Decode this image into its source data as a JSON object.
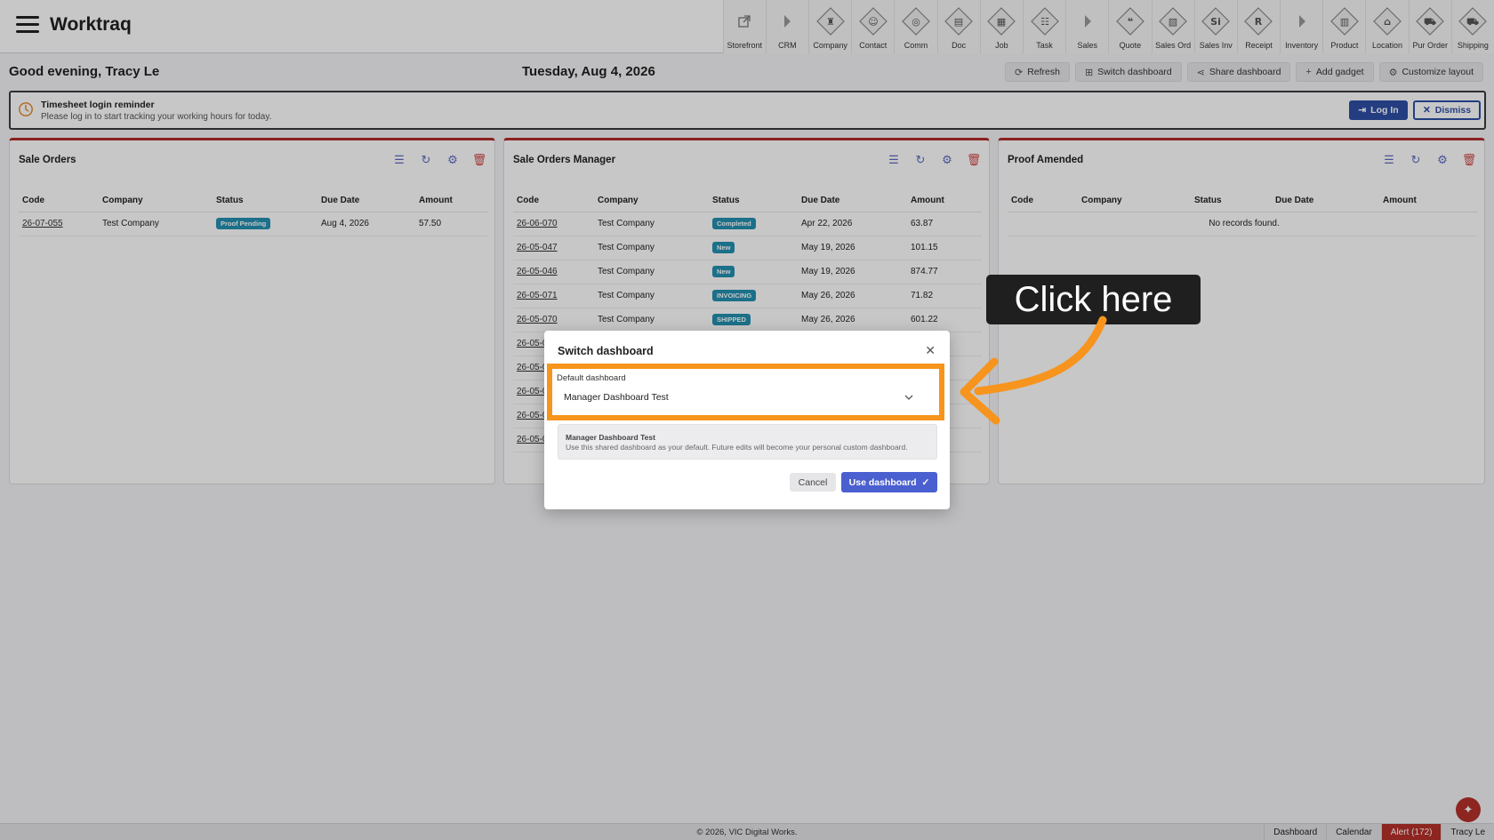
{
  "app": {
    "title": "Worktraq"
  },
  "modules": [
    {
      "label": "Storefront",
      "icon": "external-link-icon"
    },
    {
      "label": "CRM",
      "icon": "caret-right-icon"
    },
    {
      "label": "Company",
      "icon": "company-icon"
    },
    {
      "label": "Contact",
      "icon": "contact-icon"
    },
    {
      "label": "Comm",
      "icon": "comm-icon"
    },
    {
      "label": "Doc",
      "icon": "doc-icon"
    },
    {
      "label": "Job",
      "icon": "job-icon"
    },
    {
      "label": "Task",
      "icon": "task-icon"
    },
    {
      "label": "Sales",
      "icon": "caret-right-icon"
    },
    {
      "label": "Quote",
      "icon": "quote-icon"
    },
    {
      "label": "Sales Ord",
      "icon": "sales-order-icon"
    },
    {
      "label": "Sales Inv",
      "icon": "sales-invoice-icon"
    },
    {
      "label": "Receipt",
      "icon": "receipt-icon"
    },
    {
      "label": "Inventory",
      "icon": "caret-right-icon"
    },
    {
      "label": "Product",
      "icon": "product-icon"
    },
    {
      "label": "Location",
      "icon": "location-icon"
    },
    {
      "label": "Pur Order",
      "icon": "purchase-order-icon"
    },
    {
      "label": "Shipping",
      "icon": "shipping-icon"
    }
  ],
  "header": {
    "greeting": "Good evening, Tracy Le",
    "date": "Tuesday, Aug 4, 2026",
    "actions": {
      "refresh": "Refresh",
      "switch": "Switch dashboard",
      "share": "Share dashboard",
      "add": "Add gadget",
      "customize": "Customize layout"
    }
  },
  "reminder": {
    "title": "Timesheet login reminder",
    "subtitle": "Please log in to start tracking your working hours for today.",
    "login_label": "Log In",
    "dismiss_label": "Dismiss"
  },
  "columns": {
    "code": "Code",
    "company": "Company",
    "status": "Status",
    "due": "Due Date",
    "amount": "Amount"
  },
  "gadget1": {
    "title": "Sale Orders",
    "rows": [
      {
        "code": "26-07-055",
        "company": "Test Company",
        "status": "Proof Pending",
        "due": "Aug 4, 2026",
        "amount": "57.50"
      }
    ]
  },
  "gadget2": {
    "title": "Sale Orders Manager",
    "rows": [
      {
        "code": "26-06-070",
        "company": "Test Company",
        "status": "Completed",
        "due": "Apr 22, 2026",
        "amount": "63.87"
      },
      {
        "code": "26-05-047",
        "company": "Test Company",
        "status": "New",
        "due": "May 19, 2026",
        "amount": "101.15"
      },
      {
        "code": "26-05-046",
        "company": "Test Company",
        "status": "New",
        "due": "May 19, 2026",
        "amount": "874.77"
      },
      {
        "code": "26-05-071",
        "company": "Test Company",
        "status": "INVOICING",
        "due": "May 26, 2026",
        "amount": "71.82"
      },
      {
        "code": "26-05-070",
        "company": "Test Company",
        "status": "SHIPPED",
        "due": "May 26, 2026",
        "amount": "601.22"
      },
      {
        "code": "26-05-0",
        "company": "",
        "status": "",
        "due": "",
        "amount": ""
      },
      {
        "code": "26-05-0",
        "company": "",
        "status": "",
        "due": "",
        "amount": ""
      },
      {
        "code": "26-05-0",
        "company": "",
        "status": "",
        "due": "",
        "amount": ""
      },
      {
        "code": "26-05-0",
        "company": "",
        "status": "",
        "due": "",
        "amount": ""
      },
      {
        "code": "26-05-0",
        "company": "",
        "status": "",
        "due": "",
        "amount": ""
      }
    ]
  },
  "gadget3": {
    "title": "Proof Amended",
    "empty_text": "No records found."
  },
  "dialog": {
    "title": "Switch dashboard",
    "field_label": "Default dashboard",
    "selected_value": "Manager Dashboard Test",
    "info_title": "Manager Dashboard Test",
    "info_text": "Use this shared dashboard as your default. Future edits will become your personal custom dashboard.",
    "cancel_label": "Cancel",
    "use_label": "Use dashboard"
  },
  "callout": {
    "text": "Click here"
  },
  "footer": {
    "copyright": "© 2026, VIC Digital Works.",
    "nav": [
      "Dashboard",
      "Calendar",
      "Alert (172)",
      "Tracy Le"
    ]
  },
  "colors": {
    "primary": "#2d4fa5",
    "accent_button": "#4a5fd0",
    "highlight": "#f7941d",
    "gadget_border": "#b22b2b",
    "badge": "#2490b0",
    "alert": "#b5302a"
  }
}
